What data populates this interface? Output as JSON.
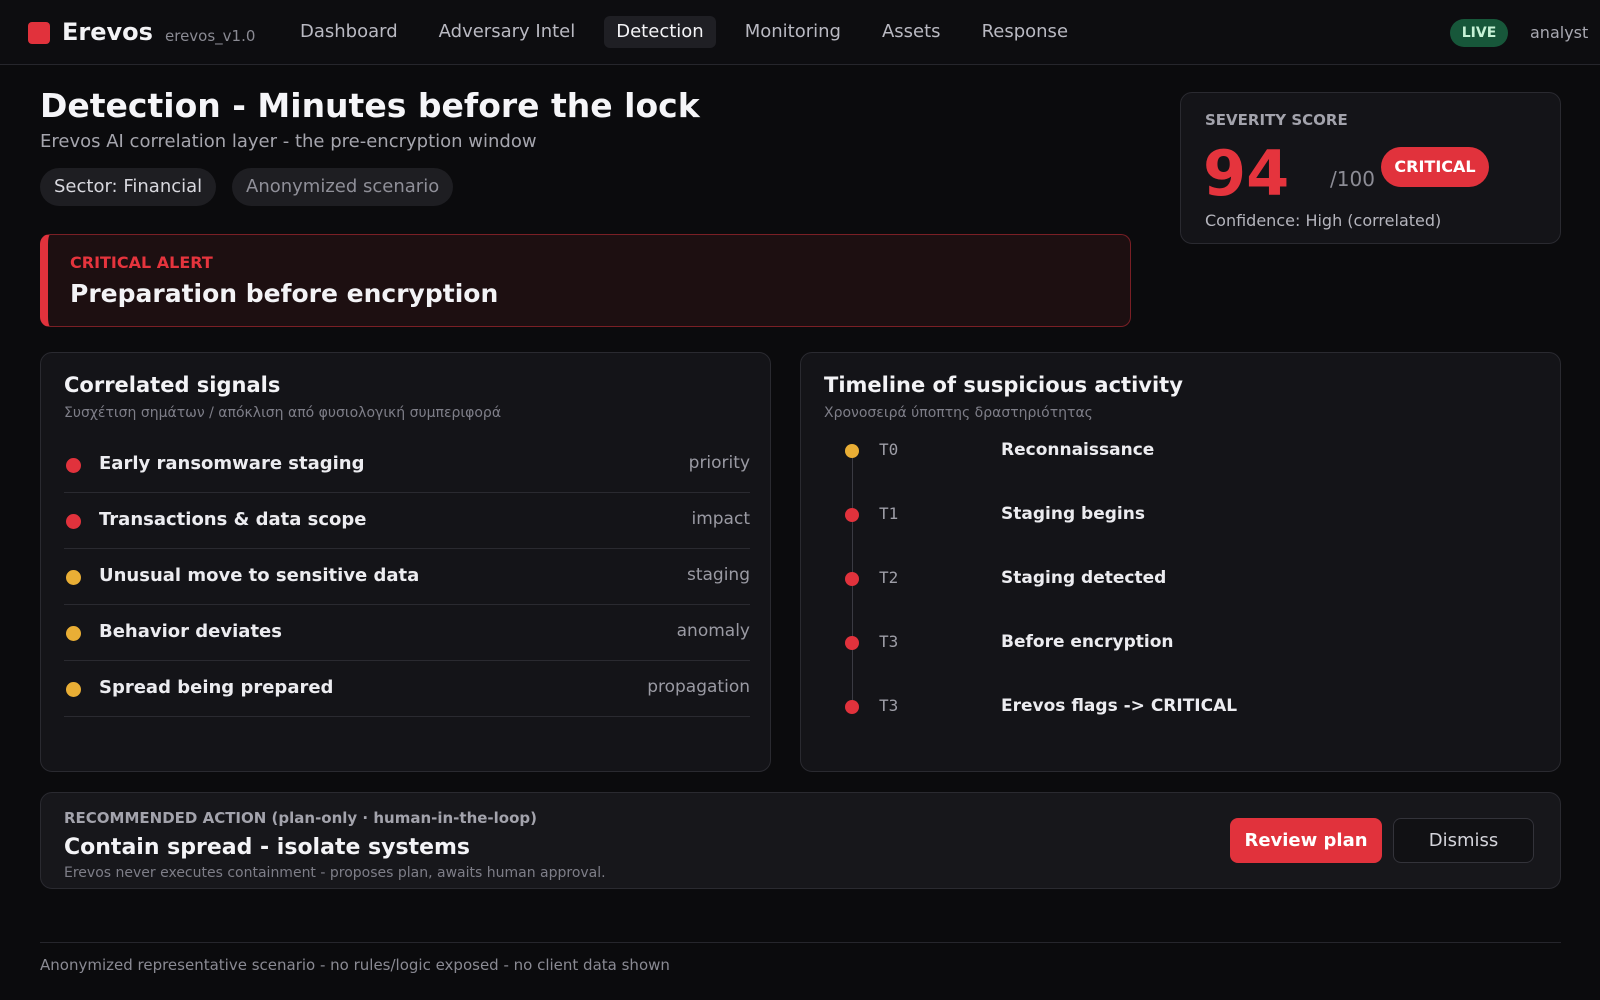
{
  "app": {
    "brand": "Erevos",
    "version": "erevos_v1.0",
    "live_label": "LIVE",
    "user": "analyst",
    "brand_color": "#e1323c"
  },
  "nav": {
    "items": [
      {
        "label": "Dashboard",
        "active": false
      },
      {
        "label": "Adversary Intel",
        "active": false
      },
      {
        "label": "Detection",
        "active": true
      },
      {
        "label": "Monitoring",
        "active": false
      },
      {
        "label": "Assets",
        "active": false
      },
      {
        "label": "Response",
        "active": false
      }
    ]
  },
  "header": {
    "title": "Detection - Minutes before the lock",
    "subtitle": "Erevos AI correlation layer - the pre-encryption window",
    "chips": [
      "Sector: Financial",
      "Anonymized scenario"
    ]
  },
  "severity": {
    "label": "SEVERITY SCORE",
    "score": "94",
    "max": "/100",
    "badge": "CRITICAL",
    "confidence": "Confidence: High (correlated)"
  },
  "alert": {
    "label": "CRITICAL ALERT",
    "title": "Preparation before encryption"
  },
  "signals": {
    "title": "Correlated signals",
    "subtitle": "Συσχέτιση σημάτων / απόκλιση από φυσιολογική συμπεριφορά",
    "items": [
      {
        "label": "Early ransomware staging",
        "tag": "priority",
        "color": "#e1323c"
      },
      {
        "label": "Transactions & data scope",
        "tag": "impact",
        "color": "#e1323c"
      },
      {
        "label": "Unusual move to sensitive data",
        "tag": "staging",
        "color": "#e9ae35"
      },
      {
        "label": "Behavior deviates",
        "tag": "anomaly",
        "color": "#e9ae35"
      },
      {
        "label": "Spread being prepared",
        "tag": "propagation",
        "color": "#e9ae35"
      }
    ]
  },
  "timeline": {
    "title": "Timeline of suspicious activity",
    "subtitle": "Χρονοσειρά ύποπτης δραστηριότητας",
    "events": [
      {
        "time": "T0",
        "event": "Reconnaissance",
        "color": "#e9ae35"
      },
      {
        "time": "T1",
        "event": "Staging begins",
        "color": "#e1323c"
      },
      {
        "time": "T2",
        "event": "Staging detected",
        "color": "#e1323c"
      },
      {
        "time": "T3",
        "event": "Before encryption",
        "color": "#e1323c"
      },
      {
        "time": "T3",
        "event": "Erevos flags -> CRITICAL",
        "color": "#e1323c"
      }
    ]
  },
  "action": {
    "label": "RECOMMENDED ACTION (plan-only · human-in-the-loop)",
    "title": "Contain spread - isolate systems",
    "note": "Erevos never executes containment - proposes plan, awaits human approval.",
    "primary_button": "Review plan",
    "secondary_button": "Dismiss"
  },
  "footer": {
    "text": "Anonymized representative scenario - no rules/logic exposed - no client data shown"
  }
}
